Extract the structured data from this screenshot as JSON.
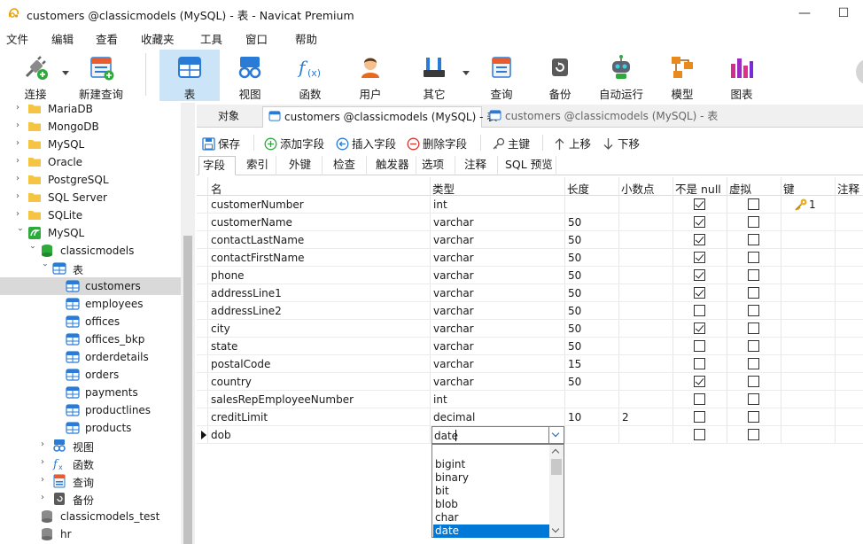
{
  "window": {
    "title": "customers @classicmodels (MySQL) - 表 - Navicat Premium",
    "minimize": "—",
    "maximize": "☐"
  },
  "menu": [
    "文件",
    "编辑",
    "查看",
    "收藏夹",
    "工具",
    "窗口",
    "帮助"
  ],
  "toolbar": {
    "connect": "连接",
    "new_query": "新建查询",
    "table": "表",
    "view": "视图",
    "function": "函数",
    "user": "用户",
    "other": "其它",
    "query": "查询",
    "backup": "备份",
    "automation": "自动运行",
    "model": "模型",
    "chart": "图表"
  },
  "sidebar": {
    "connections": [
      "MariaDB",
      "MongoDB",
      "MySQL",
      "Oracle",
      "PostgreSQL",
      "SQL Server",
      "SQLite"
    ],
    "open_connection": "MySQL",
    "database": "classicmodels",
    "tables_group": "表",
    "tables": [
      "customers",
      "employees",
      "offices",
      "offices_bkp",
      "orderdetails",
      "orders",
      "payments",
      "productlines",
      "products"
    ],
    "selected_table": "customers",
    "groups": [
      "视图",
      "函数",
      "查询",
      "备份"
    ],
    "other_databases": [
      "classicmodels_test",
      "hr"
    ]
  },
  "tabs": {
    "objects": "对象",
    "tab1": "customers @classicmodels (MySQL) - 表",
    "tab2": "customers @classicmodels (MySQL) - 表"
  },
  "actions": {
    "save": "保存",
    "add_field": "添加字段",
    "insert_field": "插入字段",
    "delete_field": "删除字段",
    "primary_key": "主键",
    "move_up": "上移",
    "move_down": "下移"
  },
  "subtabs": [
    "字段",
    "索引",
    "外键",
    "检查",
    "触发器",
    "选项",
    "注释",
    "SQL 预览"
  ],
  "grid": {
    "headers": [
      "名",
      "类型",
      "长度",
      "小数点",
      "不是 null",
      "虚拟",
      "键",
      "注释"
    ],
    "rows": [
      {
        "name": "customerNumber",
        "type": "int",
        "length": "",
        "decimals": "",
        "not_null": true,
        "virtual": false,
        "key": "1"
      },
      {
        "name": "customerName",
        "type": "varchar",
        "length": "50",
        "decimals": "",
        "not_null": true,
        "virtual": false,
        "key": ""
      },
      {
        "name": "contactLastName",
        "type": "varchar",
        "length": "50",
        "decimals": "",
        "not_null": true,
        "virtual": false,
        "key": ""
      },
      {
        "name": "contactFirstName",
        "type": "varchar",
        "length": "50",
        "decimals": "",
        "not_null": true,
        "virtual": false,
        "key": ""
      },
      {
        "name": "phone",
        "type": "varchar",
        "length": "50",
        "decimals": "",
        "not_null": true,
        "virtual": false,
        "key": ""
      },
      {
        "name": "addressLine1",
        "type": "varchar",
        "length": "50",
        "decimals": "",
        "not_null": true,
        "virtual": false,
        "key": ""
      },
      {
        "name": "addressLine2",
        "type": "varchar",
        "length": "50",
        "decimals": "",
        "not_null": false,
        "virtual": false,
        "key": ""
      },
      {
        "name": "city",
        "type": "varchar",
        "length": "50",
        "decimals": "",
        "not_null": true,
        "virtual": false,
        "key": ""
      },
      {
        "name": "state",
        "type": "varchar",
        "length": "50",
        "decimals": "",
        "not_null": false,
        "virtual": false,
        "key": ""
      },
      {
        "name": "postalCode",
        "type": "varchar",
        "length": "15",
        "decimals": "",
        "not_null": false,
        "virtual": false,
        "key": ""
      },
      {
        "name": "country",
        "type": "varchar",
        "length": "50",
        "decimals": "",
        "not_null": true,
        "virtual": false,
        "key": ""
      },
      {
        "name": "salesRepEmployeeNumber",
        "type": "int",
        "length": "",
        "decimals": "",
        "not_null": false,
        "virtual": false,
        "key": ""
      },
      {
        "name": "creditLimit",
        "type": "decimal",
        "length": "10",
        "decimals": "2",
        "not_null": false,
        "virtual": false,
        "key": ""
      },
      {
        "name": "dob",
        "type": "date",
        "length": "",
        "decimals": "",
        "not_null": false,
        "virtual": false,
        "key": ""
      }
    ],
    "editing_value": "date"
  },
  "type_dropdown": {
    "options": [
      "bigint",
      "binary",
      "bit",
      "blob",
      "char",
      "date"
    ],
    "selected": "date"
  }
}
